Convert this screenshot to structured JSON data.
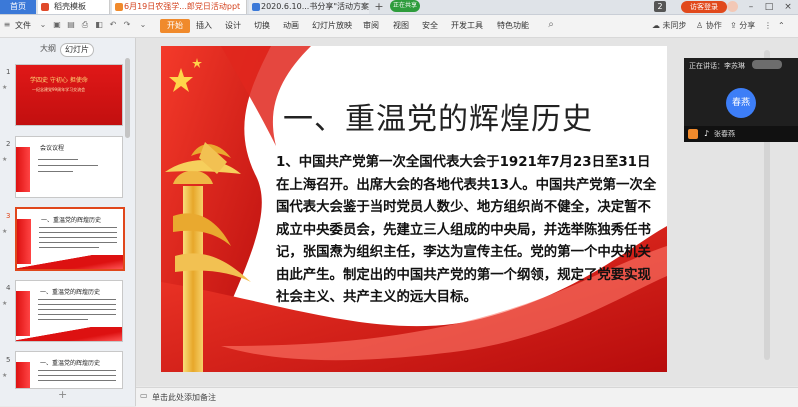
{
  "tabs": {
    "home": "首页",
    "template": "稻壳模板",
    "doc1": "6月19日农强学...郎党日活动ppt",
    "doc2": "2020.6.10...书分享\"活动方案\"",
    "status_pill": "正在共享",
    "badge_count": "2",
    "visitor": "访客登录"
  },
  "menu": {
    "file": "文件",
    "start": "开始",
    "insert": "插入",
    "design": "设计",
    "transition": "切换",
    "animation": "动画",
    "slideshow": "幻灯片放映",
    "review": "审阅",
    "view": "视图",
    "security": "安全",
    "devtools": "开发工具",
    "special": "特色功能",
    "search_placeholder": "",
    "unsynced": "未同步",
    "collab": "协作",
    "share": "分享"
  },
  "left_panel": {
    "outline_tab": "大纲",
    "slides_tab": "幻灯片",
    "thumbs": [
      {
        "num": "1",
        "title": "学四史 守初心 担使命",
        "subtitle": "—纪念建党99周年学习交流会"
      },
      {
        "num": "2",
        "title": "会议议程",
        "subtitle": ""
      },
      {
        "num": "3",
        "title": "一、重温党的辉煌历史",
        "subtitle": ""
      },
      {
        "num": "4",
        "title": "一、重温党的辉煌历史",
        "subtitle": ""
      },
      {
        "num": "5",
        "title": "一、重温党的辉煌历史",
        "subtitle": ""
      }
    ]
  },
  "slide": {
    "title": "一、重温党的辉煌历史",
    "body": "1、中国共产党第一次全国代表大会于1921年7月23日至31日在上海召开。出席大会的各地代表共13人。中国共产党第一次全国代表大会鉴于当时党员人数少、地方组织尚不健全，决定暂不成立中央委员会，先建立三人组成的中央局，并选举陈独秀任书记，张国焘为组织主任，李达为宣传主任。党的第一个中央机关由此产生。制定出的中国共产党的第一个纲领，规定了党要实现社会主义、共产主义的远大目标。"
  },
  "notes": "单击此处添加备注",
  "meeting": {
    "speaking_label": "正在讲话：李苏琳",
    "avatar_text": "春燕",
    "participant": "张春燕"
  },
  "colors": {
    "accent_orange": "#f08a2c",
    "active_red": "#e0471c",
    "flag_red": "#d9141b",
    "gold": "#f4c042"
  }
}
